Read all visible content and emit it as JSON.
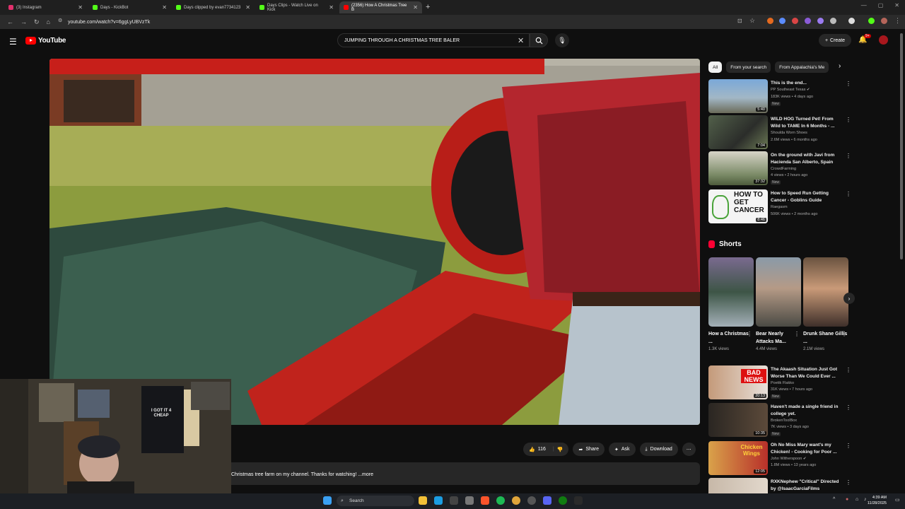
{
  "browser": {
    "tabs": [
      {
        "label": "(3) Instagram",
        "color": "#e1306c"
      },
      {
        "label": "Days - KickBot",
        "color": "#53fc18"
      },
      {
        "label": "Days clipped by evan7734123",
        "color": "#53fc18"
      },
      {
        "label": "Days Clips - Watch Live on Kick",
        "color": "#53fc18"
      },
      {
        "label": "(2356) How A Christmas Tree B",
        "color": "#ff0000"
      }
    ],
    "new_tab": "+",
    "url": "youtube.com/watch?v=6ggLyUBVzTk"
  },
  "youtube": {
    "logo_text": "YouTube",
    "search_value": "JUMPING THROUGH A CHRISTMAS TREE BALER",
    "create_label": "Create",
    "notifications_badge": "9+"
  },
  "video": {
    "like_count": "116",
    "share_label": "Share",
    "ask_label": "Ask",
    "download_label": "Download",
    "description": "Christmas tree farm on my channel. Thanks for watching! ...more"
  },
  "filter_chips": [
    "All",
    "From your search",
    "From Appalachia's Me"
  ],
  "recommendations": [
    {
      "title": "This is the end...",
      "channel": "PP Southeast Texas",
      "meta": "183K views • 4 days ago",
      "badge": "New",
      "duration": "5:40"
    },
    {
      "title": "WILD HOG Turned Pet! From Wild to TAME In 6 Months - ...",
      "channel": "Shoulda Worn Shoes",
      "meta": "2.6M views • 6 months ago",
      "badge": "",
      "duration": "7:04"
    },
    {
      "title": "On the ground with Javi from Hacienda San Alberto, Spain",
      "channel": "CrowdFarming",
      "meta": "4 views • 2 hours ago",
      "badge": "New",
      "duration": "37:32"
    },
    {
      "title": "How to Speed Run Getting Cancer - Goblins Guide",
      "channel": "Raegasm",
      "meta": "506K views • 2 months ago",
      "badge": "",
      "duration": "8:46",
      "thumb_text": "HOW TO GET CANCER"
    }
  ],
  "shorts": {
    "heading": "Shorts",
    "items": [
      {
        "title": "How a Christmas ...",
        "views": "1.3K views"
      },
      {
        "title": "Bear Nearly Attacks Ma...",
        "views": "4.4M views"
      },
      {
        "title": "Drunk Shane Gillis ...",
        "views": "2.1M views"
      }
    ]
  },
  "recommendations_2": [
    {
      "title": "The Akaash Situation Just Got Worse Than We Could Ever ...",
      "channel": "Poetik Flakko",
      "meta": "31K views • 7 hours ago",
      "badge": "New",
      "duration": "20:13",
      "thumb_text": "BAD NEWS"
    },
    {
      "title": "Haven't made a single friend in college yet.",
      "channel": "BrokenToolBox",
      "meta": "7K views • 3 days ago",
      "badge": "New",
      "duration": "10:35"
    },
    {
      "title": "Oh No Miss Mary want's my Chicken! - Cooking for Poor ...",
      "channel": "John Witherspoon",
      "meta": "1.8M views • 13 years ago",
      "badge": "",
      "duration": "12:05",
      "thumb_text": "Chicken Wings"
    },
    {
      "title": "RXKNephew \"Critical\" Directed by @IsaacGarciaFilms",
      "channel": "",
      "meta": "",
      "badge": "",
      "duration": ""
    }
  ],
  "webcam": {
    "shirt_text": "I GOT IT 4 CHEAP"
  },
  "taskbar": {
    "search_label": "Search",
    "time": "4:39 AM",
    "date": "11/28/2025"
  }
}
